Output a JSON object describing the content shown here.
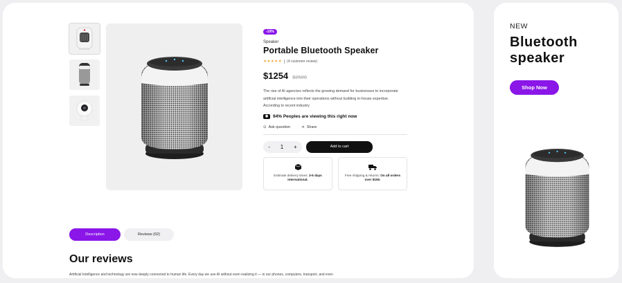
{
  "product": {
    "badge": "-10%",
    "category": "Speaker",
    "title": "Portable Bluetooth Speaker",
    "stars": "★★★★★",
    "review_count": "(4 customer review)",
    "price": "$1254",
    "old_price": "$2500",
    "description": "The rise of AI agencies reflects the growing demand for businesses to incorporate artificial intelligence into their operations without building in-house expertise. According to recent industry",
    "viewing_text": "94% Peoples are viewing this right now",
    "ask_question": "Ask question",
    "share": "Share",
    "quantity": "1",
    "qty_minus": "-",
    "qty_plus": "+",
    "add_to_cart": "Add to cart",
    "delivery_text": "Estimate delivery times: ",
    "delivery_bold": "3-5 days International.",
    "shipping_text": "Free shipping & returns: ",
    "shipping_bold": "On all orders over $150."
  },
  "tabs": {
    "description": "Description",
    "reviews": "Reviews (02)"
  },
  "reviews": {
    "heading": "Our reviews",
    "text": "Artificial Intelligence and technology are now deeply connected to human life. Every day we use AI without even realizing it — in our phones, computers, transport, and even"
  },
  "promo": {
    "new_label": "NEW",
    "title_line1": "Bluetooth",
    "title_line2": "speaker",
    "button": "Shop Now"
  },
  "colors": {
    "accent": "#8a16e8",
    "dark": "#111111",
    "star": "#f2a83a"
  },
  "icons": {
    "eye": "eye-icon",
    "ask": "question-icon",
    "share": "share-icon",
    "delivery": "box-icon",
    "shipping": "truck-icon"
  }
}
